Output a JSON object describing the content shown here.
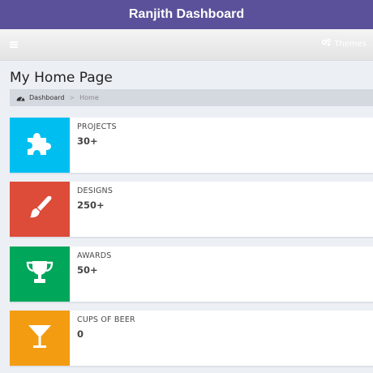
{
  "title": "Ranjith Dashboard",
  "navbar": {
    "themes_label": "Themes",
    "menu_icon": "hamburger-icon",
    "themes_icon": "gears-icon"
  },
  "page": {
    "heading": "My Home Page"
  },
  "breadcrumb": {
    "home_label": "Dashboard",
    "separator": ">",
    "current": "Home",
    "icon": "dashboard-icon"
  },
  "cards": [
    {
      "label": "PROJECTS",
      "count": "30+",
      "color": "#00bff0",
      "icon": "puzzle-icon"
    },
    {
      "label": "DESIGNS",
      "count": "250+",
      "color": "#dd4b39",
      "icon": "paintbrush-icon"
    },
    {
      "label": "AWARDS",
      "count": "50+",
      "color": "#00a65a",
      "icon": "trophy-icon"
    },
    {
      "label": "CUPS OF BEER",
      "count": "0",
      "color": "#f39c12",
      "icon": "cocktail-icon"
    }
  ],
  "colors": {
    "titlebar": "#5b519a",
    "breadcrumb_bg": "#d4d8df",
    "page_bg": "#eceff4"
  }
}
